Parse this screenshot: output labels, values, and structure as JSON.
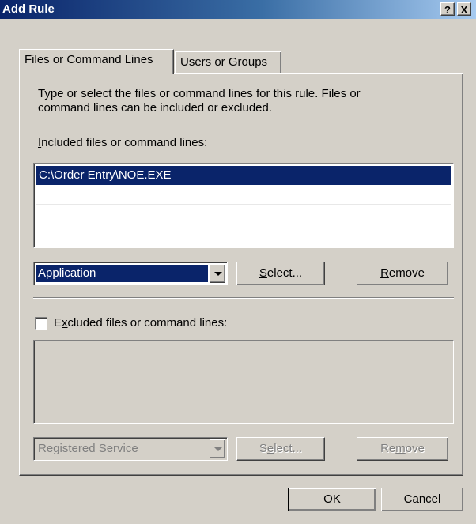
{
  "window": {
    "title": "Add Rule",
    "help_label": "?",
    "close_label": "X"
  },
  "tabs": [
    {
      "label": "Files or Command Lines",
      "active": true
    },
    {
      "label": "Users or Groups",
      "active": false
    }
  ],
  "description": {
    "line1": "Type or select the files or command lines for this rule. Files or",
    "line2": "command lines can be included or excluded."
  },
  "included": {
    "label_pre": "",
    "label_accel": "I",
    "label_post": "ncluded files or command lines:",
    "items": [
      "C:\\Order Entry\\NOE.EXE"
    ],
    "selected_index": 0,
    "type_selected": "Application",
    "select_pre": "",
    "select_accel": "S",
    "select_post": "elect...",
    "remove_pre": "",
    "remove_accel": "R",
    "remove_post": "emove"
  },
  "excluded": {
    "checked": false,
    "label_pre": "E",
    "label_accel": "x",
    "label_post": "cluded files or command lines:",
    "items": [],
    "type_selected": "Registered Service",
    "select_pre": "S",
    "select_accel": "e",
    "select_post": "lect...",
    "remove_pre": "Re",
    "remove_accel": "m",
    "remove_post": "ove"
  },
  "footer": {
    "ok_label": "OK",
    "cancel_label": "Cancel"
  },
  "colors": {
    "title_start": "#0a246a",
    "title_end": "#a6caf0",
    "selection": "#0a246a",
    "face": "#d4d0c8"
  }
}
